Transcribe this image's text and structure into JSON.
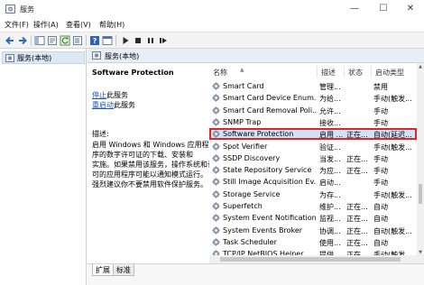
{
  "window": {
    "title": "服务",
    "minimize_glyph": "—",
    "maximize_glyph": "☐",
    "close_glyph": "✕"
  },
  "menu": {
    "items": [
      "文件(F)",
      "操作(A)",
      "查看(V)",
      "帮助(H)"
    ]
  },
  "toolbar": {
    "icons": [
      "back-arrow-icon",
      "forward-arrow-icon",
      "show-tree-icon",
      "properties-icon",
      "refresh-icon",
      "export-list-icon",
      "help-icon",
      "console-icon",
      "start-service-icon",
      "stop-service-icon",
      "pause-service-icon",
      "restart-service-icon"
    ]
  },
  "tree": {
    "selected_label": "服务(本地)"
  },
  "header": {
    "label": "服务(本地)"
  },
  "details": {
    "service_name": "Software Protection",
    "stop_link": "停止",
    "stop_suffix": "此服务",
    "restart_link": "重启动",
    "restart_suffix": "此服务",
    "description_heading": "描述:",
    "description_lines": [
      "启用 Windows 和 Windows 应用程",
      "序的数字许可证的下载、安装和",
      "实施。如果禁用该服务，操作系统和许",
      "可的应用程序可能以通知模式运行。",
      "强烈建议你不要禁用软件保护服务。"
    ]
  },
  "list": {
    "columns": [
      "名称",
      "描述",
      "状态",
      "启动类型"
    ],
    "selected_index": 4,
    "rows": [
      {
        "name": "Smart Card",
        "desc": "管理...",
        "state": "",
        "start": "禁用"
      },
      {
        "name": "Smart Card Device Enum...",
        "desc": "为给...",
        "state": "",
        "start": "手动(触发..."
      },
      {
        "name": "Smart Card Removal Poli...",
        "desc": "允许...",
        "state": "",
        "start": "手动"
      },
      {
        "name": "SNMP Trap",
        "desc": "接收...",
        "state": "",
        "start": "手动"
      },
      {
        "name": "Software Protection",
        "desc": "启用 ...",
        "state": "正在...",
        "start": "自动(延迟..."
      },
      {
        "name": "Spot Verifier",
        "desc": "验证...",
        "state": "",
        "start": "手动(触发..."
      },
      {
        "name": "SSDP Discovery",
        "desc": "当发...",
        "state": "正在...",
        "start": "手动"
      },
      {
        "name": "State Repository Service",
        "desc": "为应...",
        "state": "正在...",
        "start": "手动"
      },
      {
        "name": "Still Image Acquisition Ev...",
        "desc": "启动...",
        "state": "",
        "start": "手动"
      },
      {
        "name": "Storage Service",
        "desc": "为存...",
        "state": "",
        "start": "手动(触发..."
      },
      {
        "name": "Superfetch",
        "desc": "维护...",
        "state": "正在...",
        "start": "自动"
      },
      {
        "name": "System Event Notification...",
        "desc": "监视...",
        "state": "正在...",
        "start": "自动"
      },
      {
        "name": "System Events Broker",
        "desc": "协调...",
        "state": "正在...",
        "start": "自动(触发..."
      },
      {
        "name": "Task Scheduler",
        "desc": "使用...",
        "state": "正在...",
        "start": "自动"
      },
      {
        "name": "TCP/IP NetBIOS Helper",
        "desc": "提供...",
        "state": "正在...",
        "start": "手动(触发..."
      }
    ]
  },
  "tabs": [
    "扩展",
    "标准"
  ],
  "colors": {
    "selection_border": "#d9262c",
    "selection_fill": "#cfe3f8",
    "link": "#1a56c6"
  }
}
